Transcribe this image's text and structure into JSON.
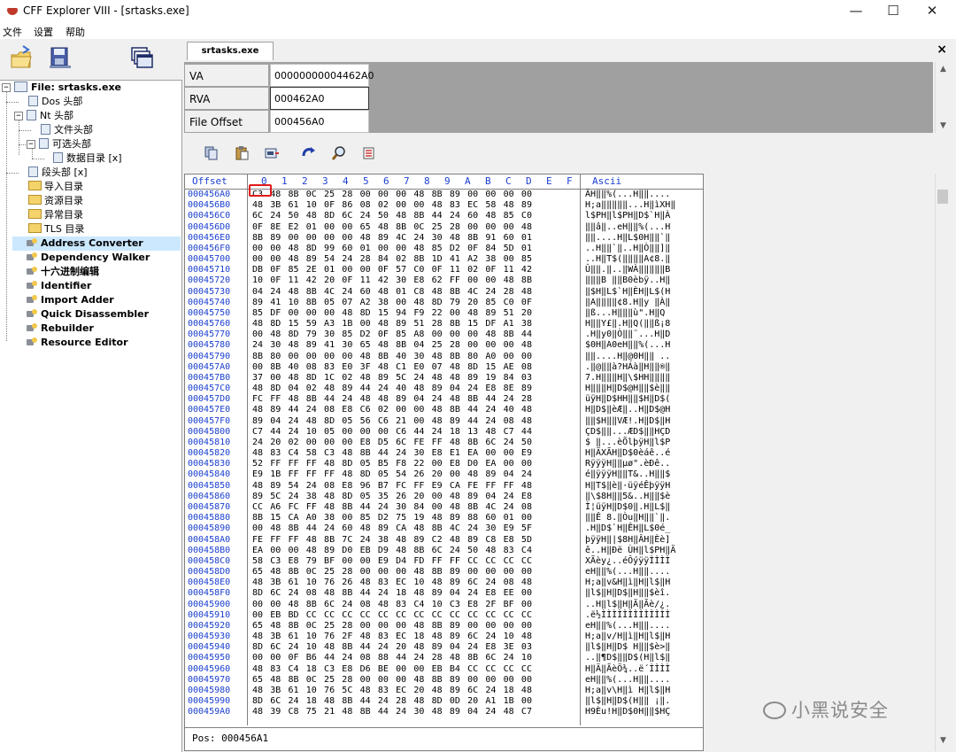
{
  "window": {
    "title": "CFF Explorer VIII - [srtasks.exe]",
    "minimize": "—",
    "maximize": "☐",
    "close": "✕"
  },
  "menu": [
    "文件",
    "设置",
    "帮助"
  ],
  "tree": {
    "root": "File: srtasks.exe",
    "items": [
      "Dos 头部",
      "Nt 头部",
      "文件头部",
      "可选头部",
      "数据目录 [x]",
      "段头部 [x]",
      "导入目录",
      "资源目录",
      "异常目录",
      "TLS 目录",
      "Address Converter",
      "Dependency Walker",
      "十六进制编辑",
      "Identifier",
      "Import Adder",
      "Quick Disassembler",
      "Rebuilder",
      "Resource Editor"
    ]
  },
  "tab": {
    "label": "srtasks.exe",
    "close": "×"
  },
  "fields": [
    {
      "label": "VA",
      "value": "00000000004462A0"
    },
    {
      "label": "RVA",
      "value": "000462A0"
    },
    {
      "label": "File Offset",
      "value": "000456A0"
    }
  ],
  "hex": {
    "header_offset": "Offset",
    "header_cols": [
      "0",
      "1",
      "2",
      "3",
      "4",
      "5",
      "6",
      "7",
      "8",
      "9",
      "A",
      "B",
      "C",
      "D",
      "E",
      "F"
    ],
    "header_ascii": "Ascii",
    "highlight_byte": "C3",
    "rows": [
      {
        "o": "000456A0",
        "b": "C3 48 8B 0C 25 28 00 00 00 48 8B 89 00 00 00 00",
        "a": "ÃH‖‖%(...H‖‖...."
      },
      {
        "o": "000456B0",
        "b": "48 3B 61 10 0F 86 08 02 00 00 48 83 EC 58 48 89",
        "a": "H;a‖‖‖‖‖...H‖ìXH‖"
      },
      {
        "o": "000456C0",
        "b": "6C 24 50 48 8D 6C 24 50 48 8B 44 24 60 48 85 C0",
        "a": "l$PH‖l$PH‖D$`H‖À"
      },
      {
        "o": "000456D0",
        "b": "0F 8E E2 01 00 00 65 48 8B 0C 25 28 00 00 00 48",
        "a": "‖‖â‖..eH‖‖%(...H"
      },
      {
        "o": "000456E0",
        "b": "8B 89 00 00 00 00 48 89 4C 24 30 48 8B 91 60 01",
        "a": "‖‖....H‖L$0H‖‖`‖"
      },
      {
        "o": "000456F0",
        "b": "00 00 48 8D 99 60 01 00 00 48 85 D2 0F 84 5D 01",
        "a": "..H‖‖`‖..H‖Ò‖‖]‖"
      },
      {
        "o": "00045700",
        "b": "00 00 48 89 54 24 28 84 02 8B 1D 41 A2 38 00 85",
        "a": "..H‖T$(‖‖‖‖A¢8.‖"
      },
      {
        "o": "00045710",
        "b": "DB 0F 85 2E 01 00 00 0F 57 C0 0F 11 02 0F 11 42",
        "a": "Û‖‖.‖..‖WÀ‖‖‖‖‖B"
      },
      {
        "o": "00045720",
        "b": "10 0F 11 42 20 0F 11 42 30 E8 62 FF 00 00 48 8B",
        "a": "‖‖‖B ‖‖B0èbÿ..H‖"
      },
      {
        "o": "00045730",
        "b": "04 24 48 8B 4C 24 60 48 01 C8 48 8B 4C 24 28 48",
        "a": "‖$H‖L$`H‖ÈH‖L$(H"
      },
      {
        "o": "00045740",
        "b": "89 41 10 8B 05 07 A2 38 00 48 8D 79 20 85 C0 0F",
        "a": "‖A‖‖‖‖¢8.H‖y ‖À‖"
      },
      {
        "o": "00045750",
        "b": "85 DF 00 00 00 48 8D 15 94 F9 22 00 48 89 51 20",
        "a": "‖ß...H‖‖‖ù\".H‖Q "
      },
      {
        "o": "00045760",
        "b": "48 8D 15 59 A3 1B 00 48 89 51 28 8B 15 DF A1 38",
        "a": "H‖‖Y£‖.H‖Q(‖‖ß¡8"
      },
      {
        "o": "00045770",
        "b": "00 48 8D 79 30 85 D2 0F 85 A8 00 00 00 48 8B 44",
        "a": ".H‖y0‖Ò‖‖¨...H‖D"
      },
      {
        "o": "00045780",
        "b": "24 30 48 89 41 30 65 48 8B 04 25 28 00 00 00 48",
        "a": "$0H‖A0eH‖‖%(...H"
      },
      {
        "o": "00045790",
        "b": "8B 80 00 00 00 00 48 8B 40 30 48 8B 80 A0 00 00",
        "a": "‖‖....H‖@0H‖‖ .."
      },
      {
        "o": "000457A0",
        "b": "00 8B 40 08 83 E0 3F 48 C1 E0 07 48 8D 15 AE 08",
        "a": ".‖@‖‖à?HÁà‖H‖‖®‖"
      },
      {
        "o": "000457B0",
        "b": "37 00 48 8D 1C 02 48 89 5C 24 48 48 89 19 84 03",
        "a": "7.H‖‖‖H‖\\$HH‖‖‖‖"
      },
      {
        "o": "000457C0",
        "b": "48 8D 04 02 48 89 44 24 40 48 89 04 24 E8 8E 89",
        "a": "H‖‖‖H‖D$@H‖‖$è‖‖"
      },
      {
        "o": "000457D0",
        "b": "FC FF 48 8B 44 24 48 48 89 04 24 48 8B 44 24 28",
        "a": "üÿH‖D$HH‖‖$H‖D$("
      },
      {
        "o": "000457E0",
        "b": "48 89 44 24 08 E8 C6 02 00 00 48 8B 44 24 40 48",
        "a": "H‖D$‖èÆ‖..H‖D$@H"
      },
      {
        "o": "000457F0",
        "b": "89 04 24 48 8D 05 56 C6 21 00 48 89 44 24 08 48",
        "a": "‖‖$H‖‖VÆ!.H‖D$‖H"
      },
      {
        "o": "00045800",
        "b": "C7 44 24 10 05 00 00 00 C6 44 24 18 13 48 C7 44",
        "a": "ÇD$‖‖...ÆD$‖‖HÇD"
      },
      {
        "o": "00045810",
        "b": "24 20 02 00 00 00 E8 D5 6C FE FF 48 8B 6C 24 50",
        "a": "$ ‖...èÕlþÿH‖l$P"
      },
      {
        "o": "00045820",
        "b": "48 83 C4 58 C3 48 8B 44 24 30 E8 E1 EA 00 00 E9",
        "a": "H‖ÄXÃH‖D$0èáê..é"
      },
      {
        "o": "00045830",
        "b": "52 FF FF FF 48 8D 05 B5 F8 22 00 E8 D0 EA 00 00",
        "a": "RÿÿÿH‖‖µø\".èÐê.."
      },
      {
        "o": "00045840",
        "b": "E9 1B FF FF FF 48 8D 05 54 26 20 00 48 89 04 24",
        "a": "é‖ÿÿÿH‖‖T&..H‖‖$"
      },
      {
        "o": "00045850",
        "b": "48 89 54 24 08 E8 96 B7 FC FF E9 CA FE FF FF 48",
        "a": "H‖T$‖è‖·üÿéÊþÿÿH"
      },
      {
        "o": "00045860",
        "b": "89 5C 24 38 48 8D 05 35 26 20 00 48 89 04 24 E8",
        "a": "‖\\$8H‖‖5&..H‖‖$è"
      },
      {
        "o": "00045870",
        "b": "CC A6 FC FF 48 8B 44 24 30 84 00 48 8B 4C 24 08",
        "a": "Ì¦üÿH‖D$0‖.H‖L$‖"
      },
      {
        "o": "00045880",
        "b": "8B 15 CA A0 38 00 85 D2 75 19 48 89 88 60 01 00",
        "a": "‖‖Ê 8.‖Òu‖H‖‖`‖."
      },
      {
        "o": "00045890",
        "b": "00 48 8B 44 24 60 48 89 CA 48 8B 4C 24 30 E9 5F",
        "a": ".H‖D$`H‖ÊH‖L$0é_"
      },
      {
        "o": "000458A0",
        "b": "FE FF FF 48 8B 7C 24 38 48 89 C2 48 89 C8 E8 5D",
        "a": "þÿÿH‖|$8H‖ÂH‖Èè]"
      },
      {
        "o": "000458B0",
        "b": "EA 00 00 48 89 D0 EB D9 48 8B 6C 24 50 48 83 C4",
        "a": "ê..H‖Ðë ÙH‖l$PH‖Ä"
      },
      {
        "o": "000458C0",
        "b": "58 C3 E8 79 BF 00 00 E9 D4 FD FF FF CC CC CC CC",
        "a": "XÃèy¿..éÔýÿÿÌÌÌÌ"
      },
      {
        "o": "000458D0",
        "b": "65 48 8B 0C 25 28 00 00 00 48 8B 89 00 00 00 00",
        "a": "eH‖‖%(...H‖‖...."
      },
      {
        "o": "000458E0",
        "b": "48 3B 61 10 76 26 48 83 EC 10 48 89 6C 24 08 48",
        "a": "H;a‖v&H‖ì‖H‖l$‖H"
      },
      {
        "o": "000458F0",
        "b": "8D 6C 24 08 48 8B 44 24 18 48 89 04 24 E8 EE 00",
        "a": "‖l$‖H‖D$‖H‖‖$èî."
      },
      {
        "o": "00045900",
        "b": "00 00 48 8B 6C 24 08 48 83 C4 10 C3 E8 2F BF 00",
        "a": "..H‖l$‖H‖Ä‖Ãè/¿."
      },
      {
        "o": "00045910",
        "b": "00 EB BD CC CC CC CC CC CC CC CC CC CC CC CC CC",
        "a": ".ë½ÌÌÌÌÌÌÌÌÌÌÌÌÌ"
      },
      {
        "o": "00045920",
        "b": "65 48 8B 0C 25 28 00 00 00 48 8B 89 00 00 00 00",
        "a": "eH‖‖%(...H‖‖...."
      },
      {
        "o": "00045930",
        "b": "48 3B 61 10 76 2F 48 83 EC 18 48 89 6C 24 10 48",
        "a": "H;a‖v/H‖ì‖H‖l$‖H"
      },
      {
        "o": "00045940",
        "b": "8D 6C 24 10 48 8B 44 24 20 48 89 04 24 E8 3E 03",
        "a": "‖l$‖H‖D$ H‖‖$è>‖"
      },
      {
        "o": "00045950",
        "b": "00 00 0F B6 44 24 08 88 44 24 28 48 8B 6C 24 10",
        "a": "..‖¶D$‖‖D$(H‖l$‖"
      },
      {
        "o": "00045960",
        "b": "48 83 C4 18 C3 E8 D6 BE 00 00 EB B4 CC CC CC CC",
        "a": "H‖Ä‖ÃèÖ¾..ë´ÌÌÌÌ"
      },
      {
        "o": "00045970",
        "b": "65 48 8B 0C 25 28 00 00 00 48 8B 89 00 00 00 00",
        "a": "eH‖‖%(...H‖‖...."
      },
      {
        "o": "00045980",
        "b": "48 3B 61 10 76 5C 48 83 EC 20 48 89 6C 24 18 48",
        "a": "H;a‖v\\H‖ì H‖l$‖H"
      },
      {
        "o": "00045990",
        "b": "8D 6C 24 18 48 8B 44 24 28 48 8D 0D 20 A1 1B 00",
        "a": "‖l$‖H‖D$(H‖‖ ¡‖."
      },
      {
        "o": "000459A0",
        "b": "48 39 C8 75 21 48 8B 44 24 30 48 89 04 24 48 C7",
        "a": "H9Èu!H‖D$0H‖‖$HÇ"
      }
    ]
  },
  "status": {
    "text": "Pos: 000456A1"
  },
  "watermark": "小黑说安全"
}
